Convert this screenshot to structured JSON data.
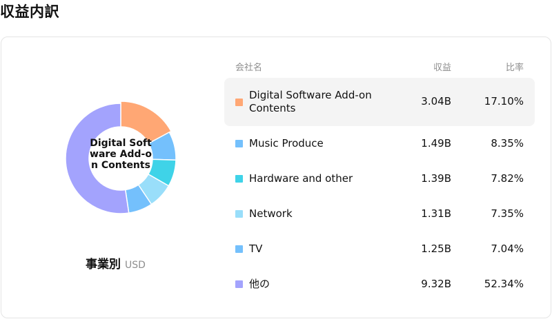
{
  "page": {
    "title": "収益内訳"
  },
  "donut": {
    "center_label": "Digital Software Add-on Contents",
    "caption_main": "事業別",
    "caption_unit": "USD"
  },
  "table": {
    "headers": {
      "name": "会社名",
      "revenue": "収益",
      "ratio": "比率"
    },
    "rows": [
      {
        "name": "Digital Software Add-on Contents",
        "revenue": "3.04B",
        "ratio": "17.10%",
        "color": "#ffa774"
      },
      {
        "name": "Music Produce",
        "revenue": "1.49B",
        "ratio": "8.35%",
        "color": "#74c0fc"
      },
      {
        "name": "Hardware and other",
        "revenue": "1.39B",
        "ratio": "7.82%",
        "color": "#3fd3e8"
      },
      {
        "name": "Network",
        "revenue": "1.31B",
        "ratio": "7.35%",
        "color": "#99defa"
      },
      {
        "name": "TV",
        "revenue": "1.25B",
        "ratio": "7.04%",
        "color": "#74c0fc"
      },
      {
        "name": "他の",
        "revenue": "9.32B",
        "ratio": "52.34%",
        "color": "#a3a3fd"
      }
    ]
  },
  "chart_data": {
    "type": "pie",
    "categories": [
      "Digital Software Add-on Contents",
      "Music Produce",
      "Hardware and other",
      "Network",
      "TV",
      "他の"
    ],
    "values": [
      17.1,
      8.35,
      7.82,
      7.35,
      7.04,
      52.34
    ],
    "revenue": [
      "3.04B",
      "1.49B",
      "1.39B",
      "1.31B",
      "1.25B",
      "9.32B"
    ],
    "colors": [
      "#ffa774",
      "#74c0fc",
      "#3fd3e8",
      "#99defa",
      "#74c0fc",
      "#a3a3fd"
    ],
    "title": "",
    "highlighted": "Digital Software Add-on Contents",
    "unit": "USD"
  }
}
